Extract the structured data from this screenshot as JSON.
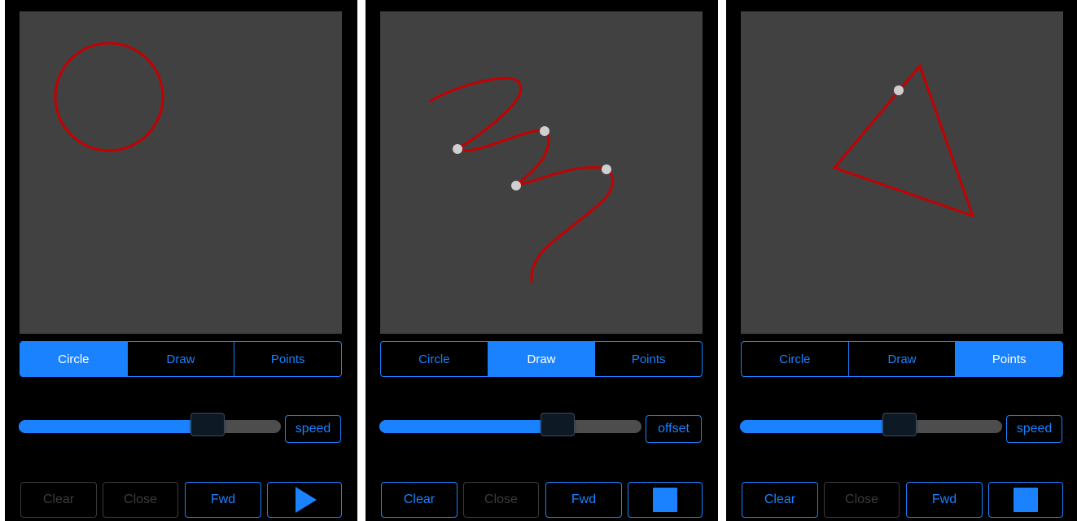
{
  "colors": {
    "accent": "#1a82ff",
    "stroke": "#c40000",
    "canvas": "#414141",
    "point": "#cfcfcf"
  },
  "panels": [
    {
      "segments": [
        "Circle",
        "Draw",
        "Points"
      ],
      "selected_segment": "Circle",
      "slider_value": 0.72,
      "slider_label": "speed",
      "buttons": {
        "clear": "Clear",
        "close": "Close",
        "fwd": "Fwd"
      },
      "clear_enabled": false,
      "close_enabled": false,
      "action_icon": "play-icon"
    },
    {
      "segments": [
        "Circle",
        "Draw",
        "Points"
      ],
      "selected_segment": "Draw",
      "slider_value": 0.68,
      "slider_label": "offset",
      "buttons": {
        "clear": "Clear",
        "close": "Close",
        "fwd": "Fwd"
      },
      "clear_enabled": true,
      "close_enabled": false,
      "action_icon": "stop-icon"
    },
    {
      "segments": [
        "Circle",
        "Draw",
        "Points"
      ],
      "selected_segment": "Points",
      "slider_value": 0.61,
      "slider_label": "speed",
      "buttons": {
        "clear": "Clear",
        "close": "Close",
        "fwd": "Fwd"
      },
      "clear_enabled": true,
      "close_enabled": false,
      "action_icon": "stop-icon"
    }
  ]
}
